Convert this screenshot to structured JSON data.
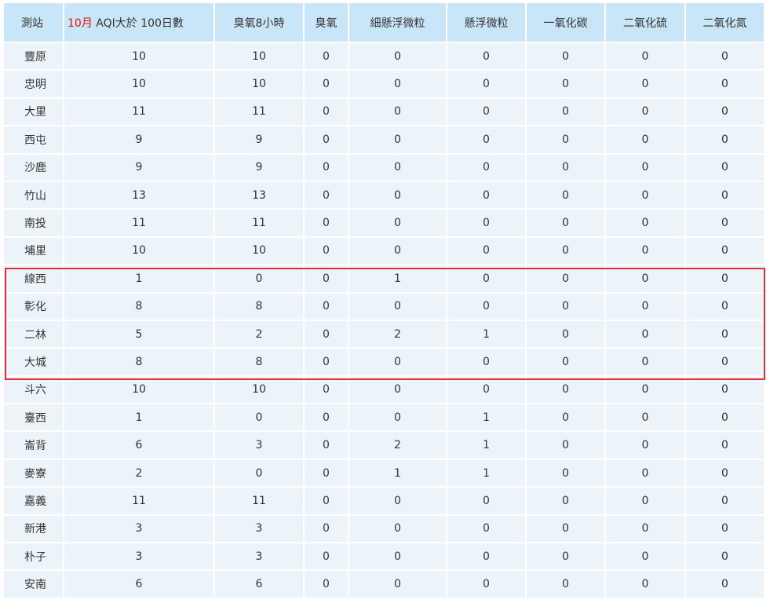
{
  "headers": {
    "station": "測站",
    "month": "10月",
    "aqi_days": "AQI大於 100日數",
    "ozone_8hr": "臭氧8小時",
    "ozone": "臭氧",
    "pm25": "細懸浮微粒",
    "pm10": "懸浮微粒",
    "co": "一氧化碳",
    "so2": "二氧化硫",
    "no2": "二氧化氮"
  },
  "rows": [
    [
      "豐原",
      "10",
      "10",
      "0",
      "0",
      "0",
      "0",
      "0",
      "0"
    ],
    [
      "忠明",
      "10",
      "10",
      "0",
      "0",
      "0",
      "0",
      "0",
      "0"
    ],
    [
      "大里",
      "11",
      "11",
      "0",
      "0",
      "0",
      "0",
      "0",
      "0"
    ],
    [
      "西屯",
      "9",
      "9",
      "0",
      "0",
      "0",
      "0",
      "0",
      "0"
    ],
    [
      "沙鹿",
      "9",
      "9",
      "0",
      "0",
      "0",
      "0",
      "0",
      "0"
    ],
    [
      "竹山",
      "13",
      "13",
      "0",
      "0",
      "0",
      "0",
      "0",
      "0"
    ],
    [
      "南投",
      "11",
      "11",
      "0",
      "0",
      "0",
      "0",
      "0",
      "0"
    ],
    [
      "埔里",
      "10",
      "10",
      "0",
      "0",
      "0",
      "0",
      "0",
      "0"
    ],
    [
      "線西",
      "1",
      "0",
      "0",
      "1",
      "0",
      "0",
      "0",
      "0"
    ],
    [
      "彰化",
      "8",
      "8",
      "0",
      "0",
      "0",
      "0",
      "0",
      "0"
    ],
    [
      "二林",
      "5",
      "2",
      "0",
      "2",
      "1",
      "0",
      "0",
      "0"
    ],
    [
      "大城",
      "8",
      "8",
      "0",
      "0",
      "0",
      "0",
      "0",
      "0"
    ],
    [
      "斗六",
      "10",
      "10",
      "0",
      "0",
      "0",
      "0",
      "0",
      "0"
    ],
    [
      "臺西",
      "1",
      "0",
      "0",
      "0",
      "1",
      "0",
      "0",
      "0"
    ],
    [
      "崙背",
      "6",
      "3",
      "0",
      "2",
      "1",
      "0",
      "0",
      "0"
    ],
    [
      "麥寮",
      "2",
      "0",
      "0",
      "1",
      "1",
      "0",
      "0",
      "0"
    ],
    [
      "嘉義",
      "11",
      "11",
      "0",
      "0",
      "0",
      "0",
      "0",
      "0"
    ],
    [
      "新港",
      "3",
      "3",
      "0",
      "0",
      "0",
      "0",
      "0",
      "0"
    ],
    [
      "朴子",
      "3",
      "3",
      "0",
      "0",
      "0",
      "0",
      "0",
      "0"
    ],
    [
      "安南",
      "6",
      "6",
      "0",
      "0",
      "0",
      "0",
      "0",
      "0"
    ]
  ],
  "highlight": {
    "stations": [
      "線西",
      "彰化",
      "二林",
      "大城"
    ],
    "color": "#e0303a"
  },
  "colors": {
    "header_bg": "#c9e6f8",
    "row_bg": "#edf4f9",
    "month_text": "#e01010"
  }
}
